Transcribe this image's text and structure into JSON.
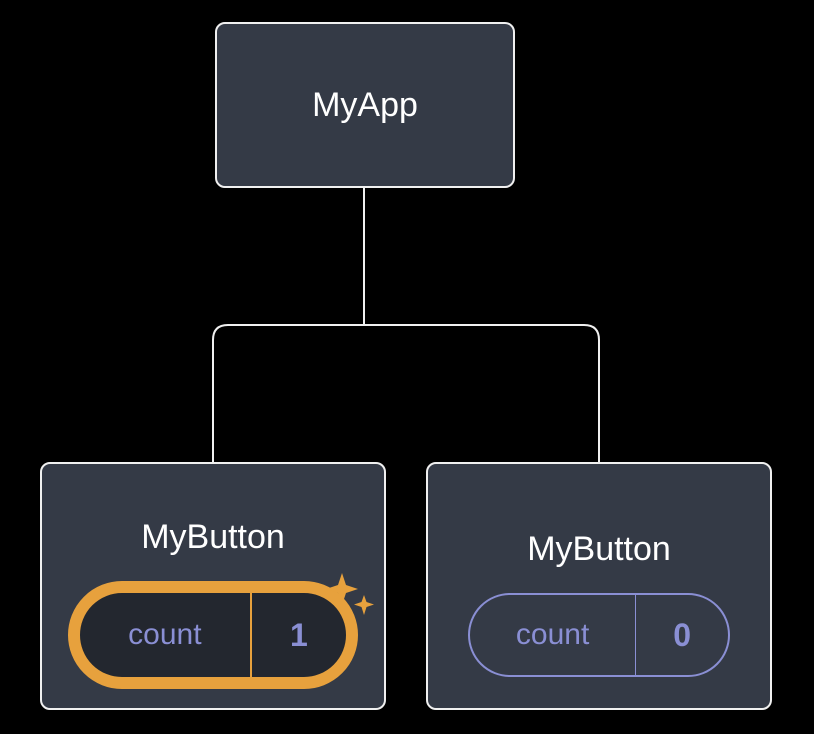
{
  "root": {
    "label": "MyApp"
  },
  "children": [
    {
      "label": "MyButton",
      "countLabel": "count",
      "countValue": "1",
      "active": true
    },
    {
      "label": "MyButton",
      "countLabel": "count",
      "countValue": "0",
      "active": false
    }
  ],
  "colors": {
    "nodeBg": "#343a46",
    "nodeBorder": "#f0f0f0",
    "accent": "#e7a13d",
    "purple": "#8a8fd4"
  }
}
